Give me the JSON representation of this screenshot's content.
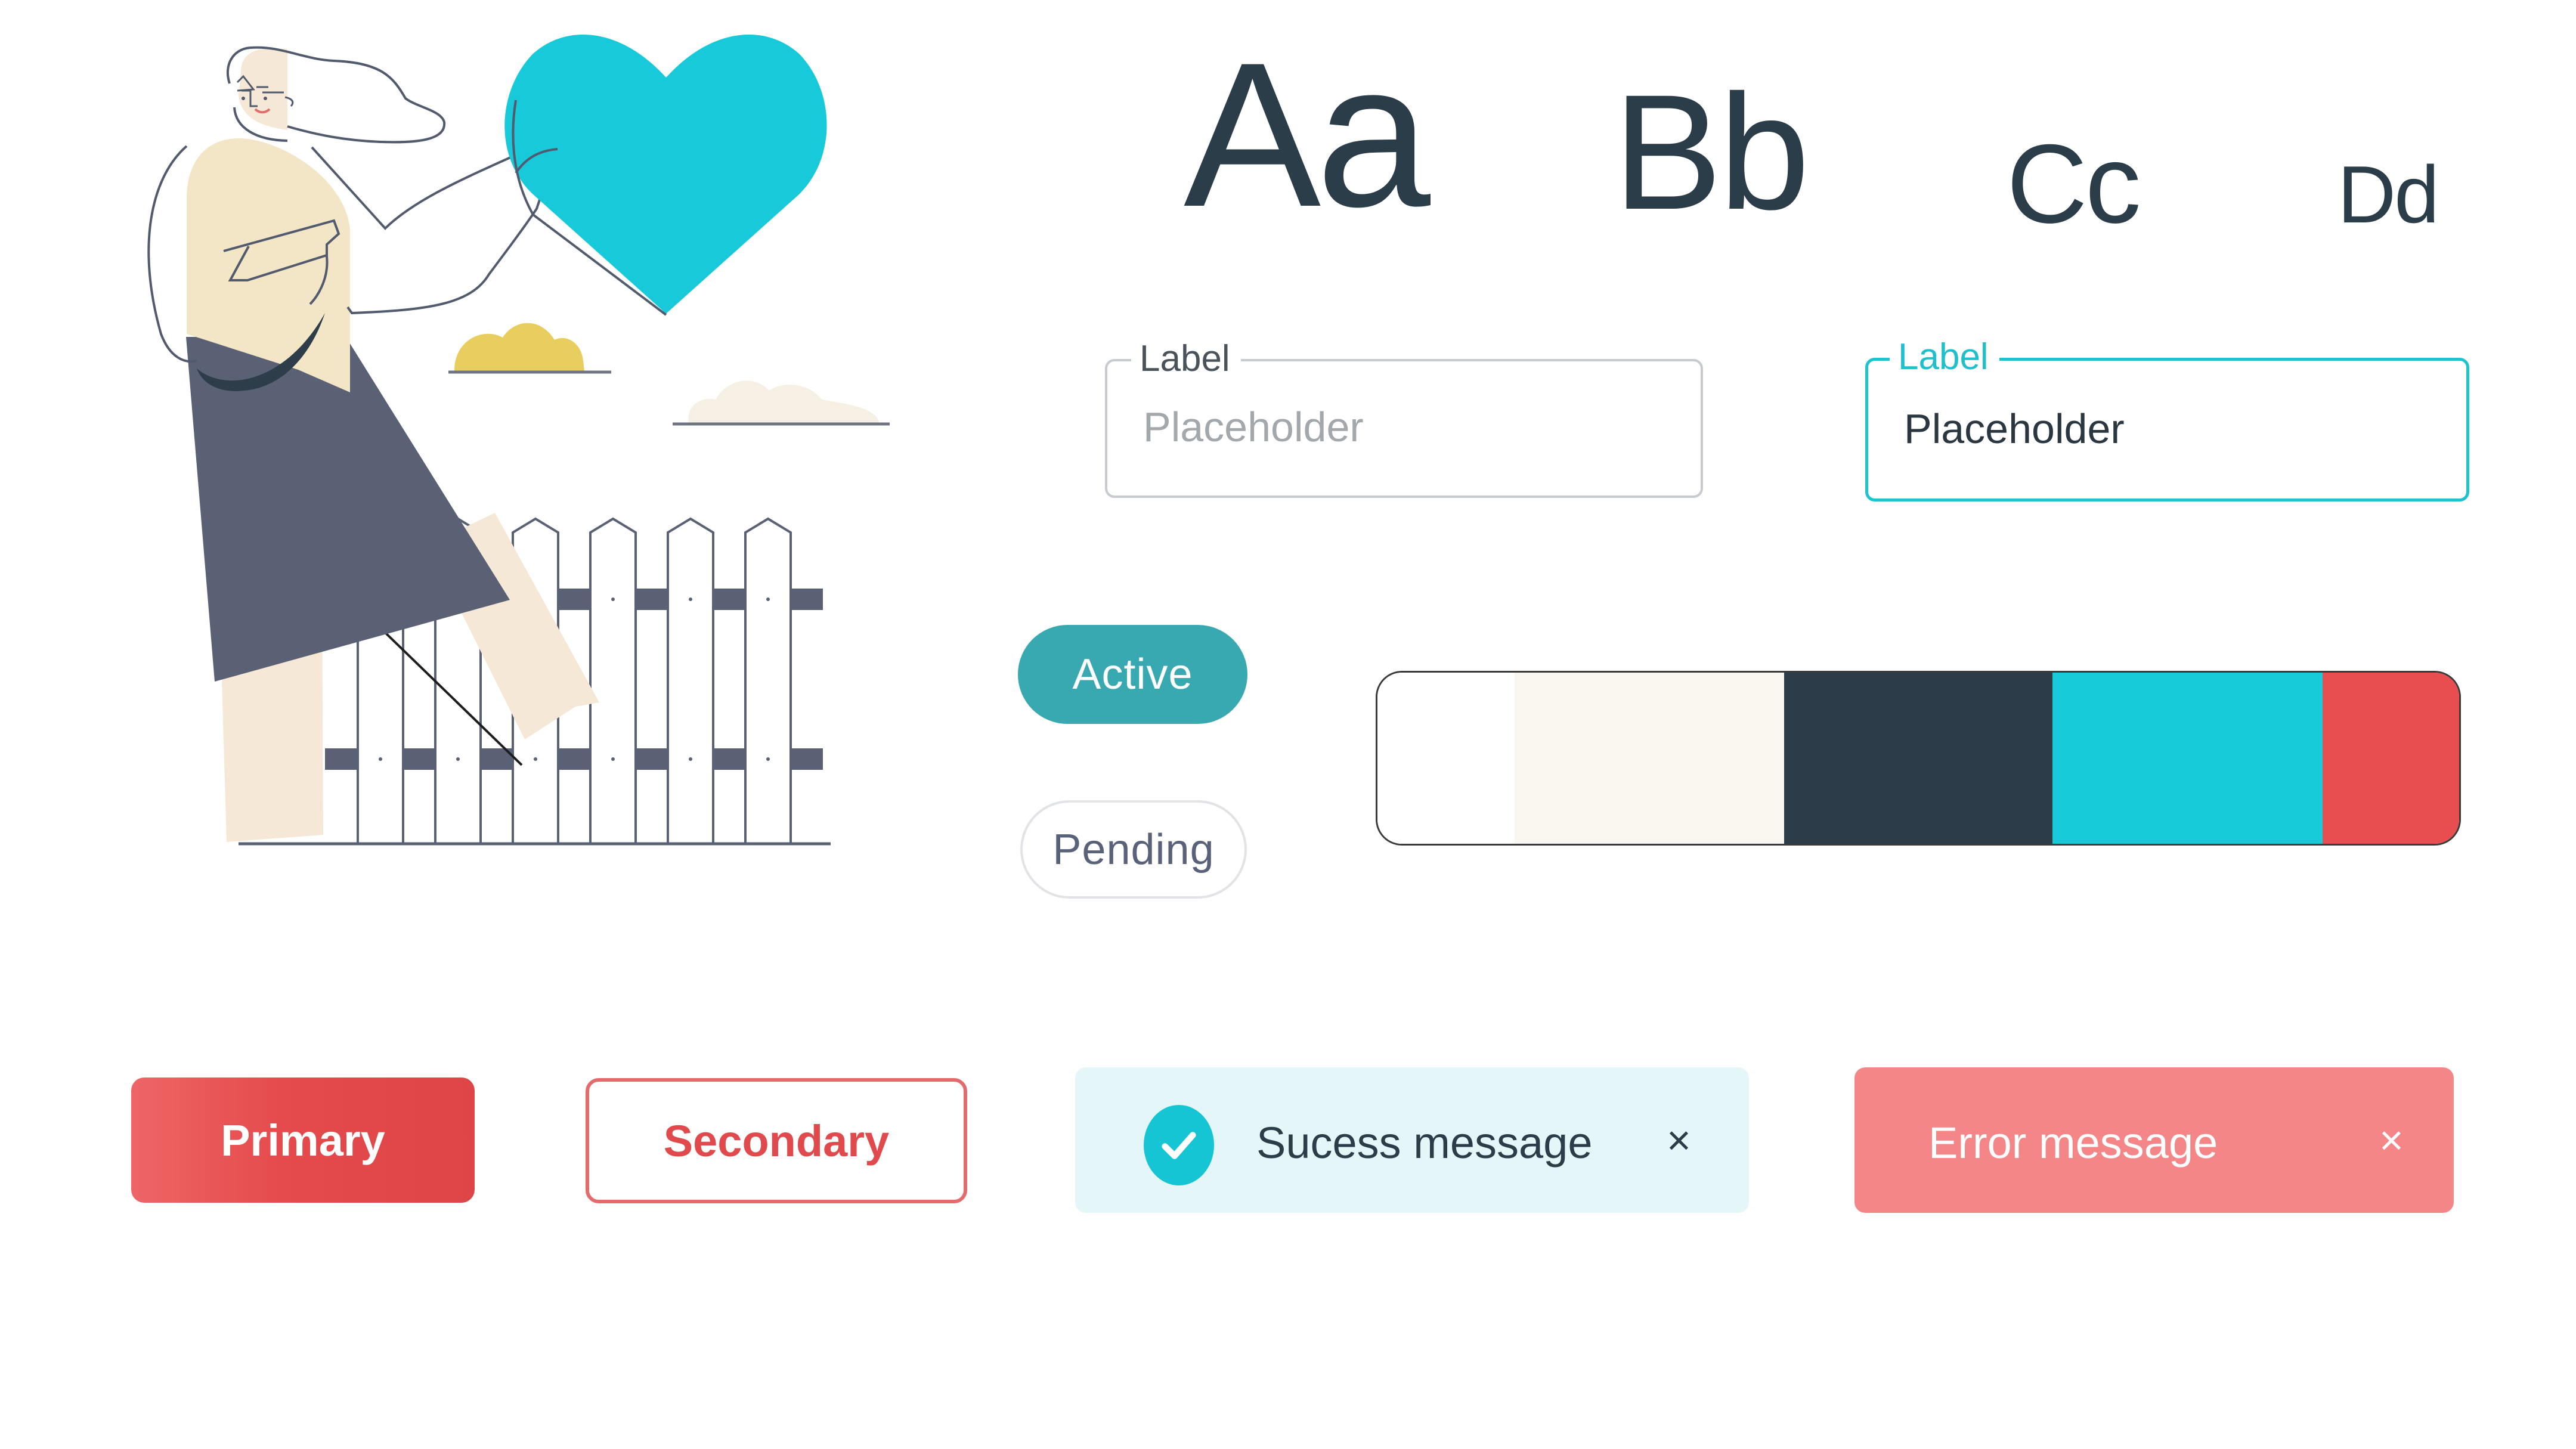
{
  "illustration": {
    "subject": "woman-holding-heart-by-fence",
    "colors": {
      "heart": "#17c9d9",
      "skirt": "#5a6175",
      "top": "#f3e6c6",
      "skin": "#f5e8d6",
      "outline": "#525a6e",
      "bag_strap": "#2d3d4a",
      "cloud_yellow": "#e8cd5f",
      "cloud_cream": "#f6efe3",
      "fence_rail": "#5a6175"
    }
  },
  "typography": {
    "specimens": [
      "Aa",
      "Bb",
      "Cc",
      "Dd"
    ]
  },
  "fields": {
    "default": {
      "label": "Label",
      "placeholder": "Placeholder",
      "value": ""
    },
    "focused": {
      "label": "Label",
      "placeholder": "Placeholder",
      "value": "Placeholder"
    }
  },
  "status_pills": {
    "active": "Active",
    "pending": "Pending"
  },
  "palette": {
    "swatches": [
      {
        "name": "white",
        "color": "#ffffff",
        "share": 0.127
      },
      {
        "name": "cream",
        "color": "#faf7f1",
        "share": 0.249
      },
      {
        "name": "dark-slate",
        "color": "#2c3c48",
        "share": 0.248
      },
      {
        "name": "cyan",
        "color": "#16cad8",
        "share": 0.25
      },
      {
        "name": "red",
        "color": "#e84e4f",
        "share": 0.126
      }
    ]
  },
  "buttons": {
    "primary": "Primary",
    "secondary": "Secondary"
  },
  "alerts": {
    "success": {
      "text": "Sucess message",
      "icon": "check-circle-icon",
      "close": "×"
    },
    "error": {
      "text": "Error message",
      "close": "×"
    }
  },
  "colors": {
    "accent_cyan": "#16c9d8",
    "accent_teal": "#38a9b0",
    "danger": "#e54a4c",
    "danger_light": "#f58688",
    "text_dark": "#2c3d4a"
  }
}
